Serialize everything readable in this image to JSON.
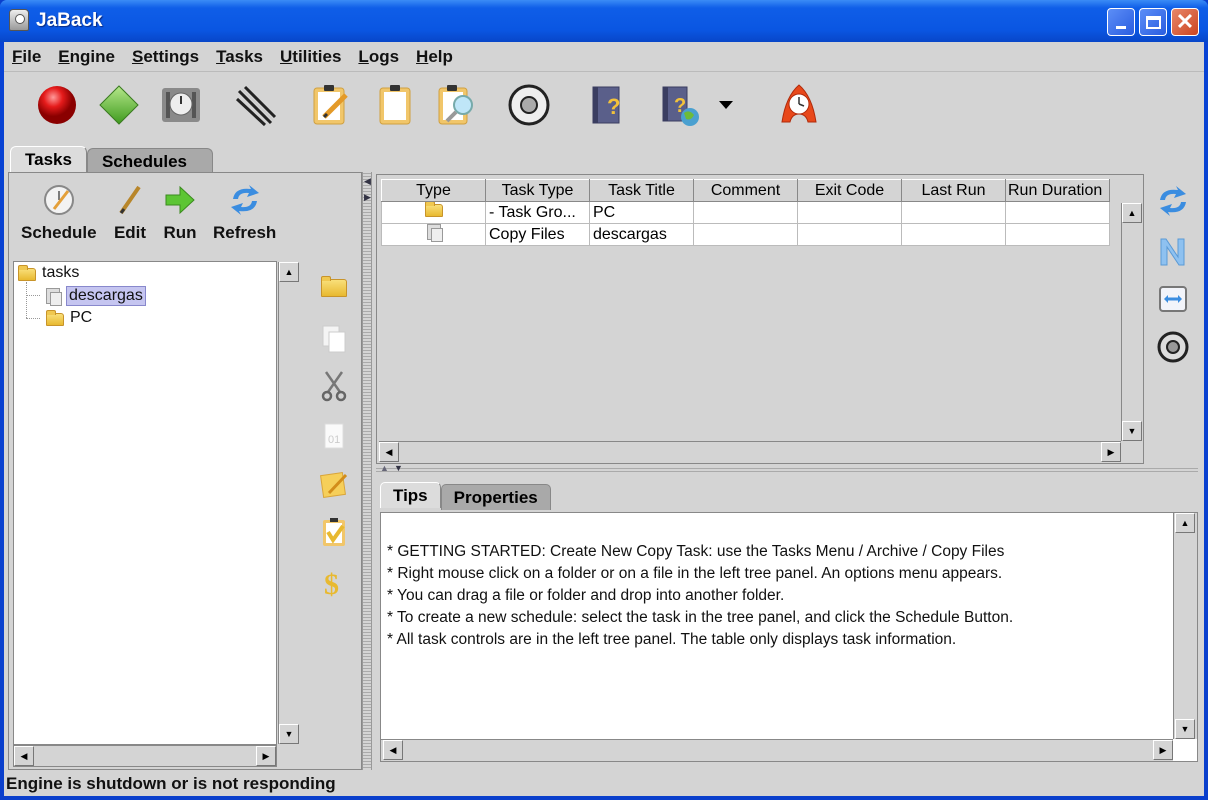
{
  "window": {
    "title": "JaBack"
  },
  "menu": [
    "File",
    "Engine",
    "Settings",
    "Tasks",
    "Utilities",
    "Logs",
    "Help"
  ],
  "toolbar": {
    "icons": [
      "stop-engine-icon",
      "start-engine-icon",
      "scheduler-icon",
      "link-icon",
      "edit-task-icon",
      "new-task-icon",
      "find-task-icon",
      "settings-disc-icon",
      "help-book-icon",
      "online-help-icon",
      "dropdown-arrow-icon",
      "alarm-clock-icon"
    ]
  },
  "main_tabs": [
    {
      "label": "Tasks",
      "active": true
    },
    {
      "label": "Schedules",
      "active": false
    }
  ],
  "left_panel": {
    "buttons": [
      {
        "label": "Schedule",
        "icon": "schedule-clock-icon"
      },
      {
        "label": "Edit",
        "icon": "pen-icon"
      },
      {
        "label": "Run",
        "icon": "green-arrow-icon"
      },
      {
        "label": "Refresh",
        "icon": "refresh-icon"
      }
    ],
    "tree": {
      "root": "tasks",
      "children": [
        {
          "label": "descargas",
          "type": "copy-files",
          "selected": true
        },
        {
          "label": "PC",
          "type": "folder",
          "selected": false
        }
      ]
    },
    "side_icons": [
      "new-folder-icon",
      "copy-icon",
      "cut-icon",
      "paste-icon",
      "edit-note-icon",
      "check-clipboard-icon",
      "dollar-icon"
    ]
  },
  "table": {
    "columns": [
      "Type",
      "Task Type",
      "Task Title",
      "Comment",
      "Exit Code",
      "Last Run",
      "Run Duration"
    ],
    "rows": [
      {
        "type_icon": "folder",
        "task_type": "- Task Gro...",
        "task_title": "PC",
        "comment": "",
        "exit_code": "",
        "last_run": "",
        "run_duration": ""
      },
      {
        "type_icon": "copy-files",
        "task_type": "Copy Files",
        "task_title": "descargas",
        "comment": "",
        "exit_code": "",
        "last_run": "",
        "run_duration": ""
      }
    ]
  },
  "right_icons": [
    "refresh-table-icon",
    "sort-icon",
    "fit-columns-icon",
    "disc-icon"
  ],
  "bottom_tabs": [
    {
      "label": "Tips",
      "active": true
    },
    {
      "label": "Properties",
      "active": false
    }
  ],
  "tips": [
    "*  GETTING STARTED: Create New Copy Task: use the Tasks Menu / Archive / Copy Files",
    "*  Right mouse click on a folder or on a file in the left tree panel.  An options menu appears.",
    "*  You can drag a file or folder and drop into another folder.",
    "*  To create a new schedule: select the task in the tree panel, and click the Schedule Button.",
    "*  All task controls are in the left tree panel.  The table only displays task information."
  ],
  "status": "Engine is shutdown or is not responding"
}
